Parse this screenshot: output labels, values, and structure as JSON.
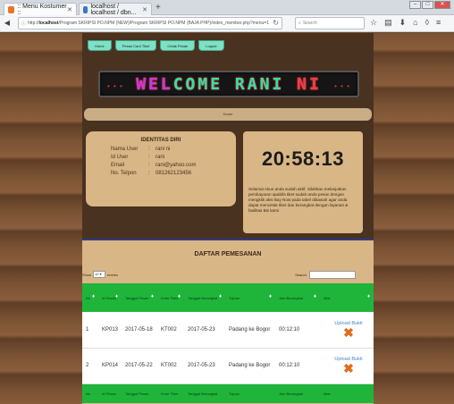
{
  "browser": {
    "tabs": [
      {
        "label": ":: Menu Kostumer ::",
        "favicon_color": "#e8742a"
      },
      {
        "label": "localhost / localhost / dbn...",
        "favicon_color": "#3a78c4"
      }
    ],
    "new_tab": "+",
    "url_prefix": "http://",
    "url_host": "localhost",
    "url_path": "/Program SKRIPSI PO.NPM (NEW)/Program SKRIPSI PO.NPM (BAJA PHP)/index_member.php?menu=1",
    "search_placeholder": "Search"
  },
  "nav": {
    "items": [
      "Home",
      "Pesan Card Tiket",
      "Cetak Pesan",
      "Logout"
    ]
  },
  "banner": {
    "parts": [
      "WEL",
      "COME",
      " RANI",
      " NI"
    ],
    "dots_left": "• • •",
    "dots_right": "• • •"
  },
  "breadcrumb": "Home",
  "identity": {
    "title": "IDENTITAS DIRI",
    "rows": [
      {
        "key": "Nama User",
        "value": "rani ni"
      },
      {
        "key": "Id User",
        "value": "rani"
      },
      {
        "key": "Email",
        "value": "rani@yahoo.com"
      },
      {
        "key": "No. Telpon",
        "value": "081262123456"
      }
    ],
    "separator": ":"
  },
  "clock": {
    "time": "20:58:13",
    "message": "Selamat Akun anda sudah aktif. Silahkan melanjutkan pembayaran apabila tiket sudah anda pesan dengan mengklik aksi Bay Now pada tabel dibawah agar anda dapat mencetak tiket dan berangkat dengan layanan & fasilitas Bis kami"
  },
  "orders": {
    "title": "DAFTAR PEMESANAN",
    "show_label": "Show",
    "show_value": "10",
    "entries_label": "entries",
    "search_label": "Search:",
    "columns": [
      "No",
      "Id Pesan",
      "Tanggal Pesan",
      "Kode Tiket",
      "Tanggal Berangkat",
      "Tujuan",
      "Jam Berangkat",
      "Aksi"
    ],
    "rows": [
      {
        "no": "1",
        "id": "KP013",
        "tgl_pesan": "2017-05-18",
        "kode": "KT002",
        "tgl_berangkat": "2017-05-23",
        "tujuan": "Padang ke Bogor",
        "jam": "00:12:10",
        "aksi": "Upload Bukti"
      },
      {
        "no": "2",
        "id": "KP014",
        "tgl_pesan": "2017-05-22",
        "kode": "KT002",
        "tgl_berangkat": "2017-05-23",
        "tujuan": "Padang ke Bogor",
        "jam": "00:12:10",
        "aksi": "Upload Bukti"
      }
    ]
  }
}
